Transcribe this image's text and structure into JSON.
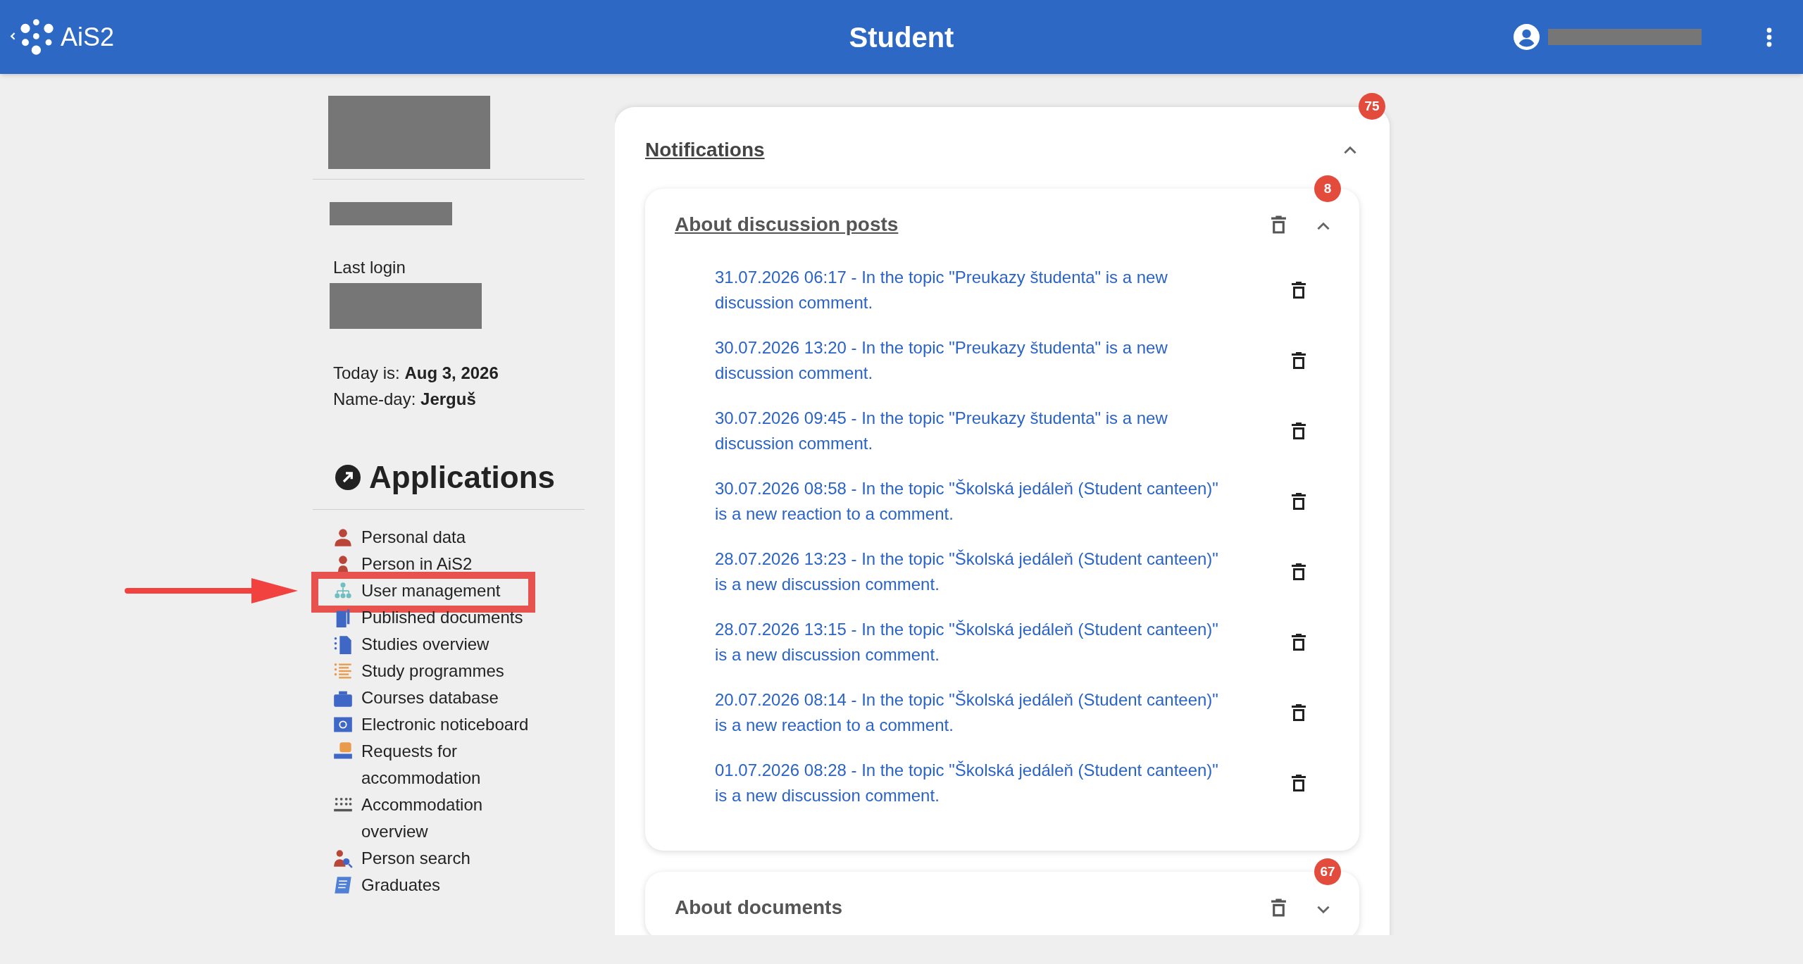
{
  "header": {
    "logo_text": "AiS2",
    "title": "Student"
  },
  "sidebar": {
    "last_login_label": "Last login",
    "today_label": "Today is:",
    "today_value": "Aug 3, 2026",
    "nameday_label": "Name-day:",
    "nameday_value": "Jerguš",
    "applications_title": "Applications",
    "applications": [
      {
        "label": "Personal data",
        "annotated": false
      },
      {
        "label": "Person in AiS2",
        "annotated": false
      },
      {
        "label": "User management",
        "annotated": true
      },
      {
        "label": "Published documents",
        "annotated": false
      },
      {
        "label": "Studies overview",
        "annotated": false
      },
      {
        "label": "Study programmes",
        "annotated": false
      },
      {
        "label": "Courses database",
        "annotated": false
      },
      {
        "label": "Electronic noticeboard",
        "annotated": false
      },
      {
        "label": "Requests for accommodation",
        "annotated": false
      },
      {
        "label": "Accommodation overview",
        "annotated": false
      },
      {
        "label": "Person search",
        "annotated": false
      },
      {
        "label": "Graduates",
        "annotated": false
      }
    ]
  },
  "notifications": {
    "title": "Notifications",
    "badge": "75",
    "expanded": true,
    "groups": [
      {
        "title": "About discussion posts",
        "badge": "8",
        "expanded": true,
        "items": [
          "31.07.2026 06:17 - In the topic \"Preukazy študenta\" is a new discussion comment.",
          "30.07.2026 13:20 - In the topic \"Preukazy študenta\" is a new discussion comment.",
          "30.07.2026 09:45 - In the topic \"Preukazy študenta\" is a new discussion comment.",
          "30.07.2026 08:58 - In the topic \"Školská jedáleň (Student canteen)\" is a new reaction to a comment.",
          "28.07.2026 13:23 - In the topic \"Školská jedáleň (Student canteen)\" is a new discussion comment.",
          "28.07.2026 13:15 - In the topic \"Školská jedáleň (Student canteen)\" is a new discussion comment.",
          "20.07.2026 08:14 - In the topic \"Školská jedáleň (Student canteen)\" is a new reaction to a comment.",
          "01.07.2026 08:28 - In the topic \"Školská jedáleň (Student canteen)\" is a new discussion comment."
        ]
      },
      {
        "title": "About documents",
        "badge": "67",
        "expanded": false
      }
    ]
  }
}
